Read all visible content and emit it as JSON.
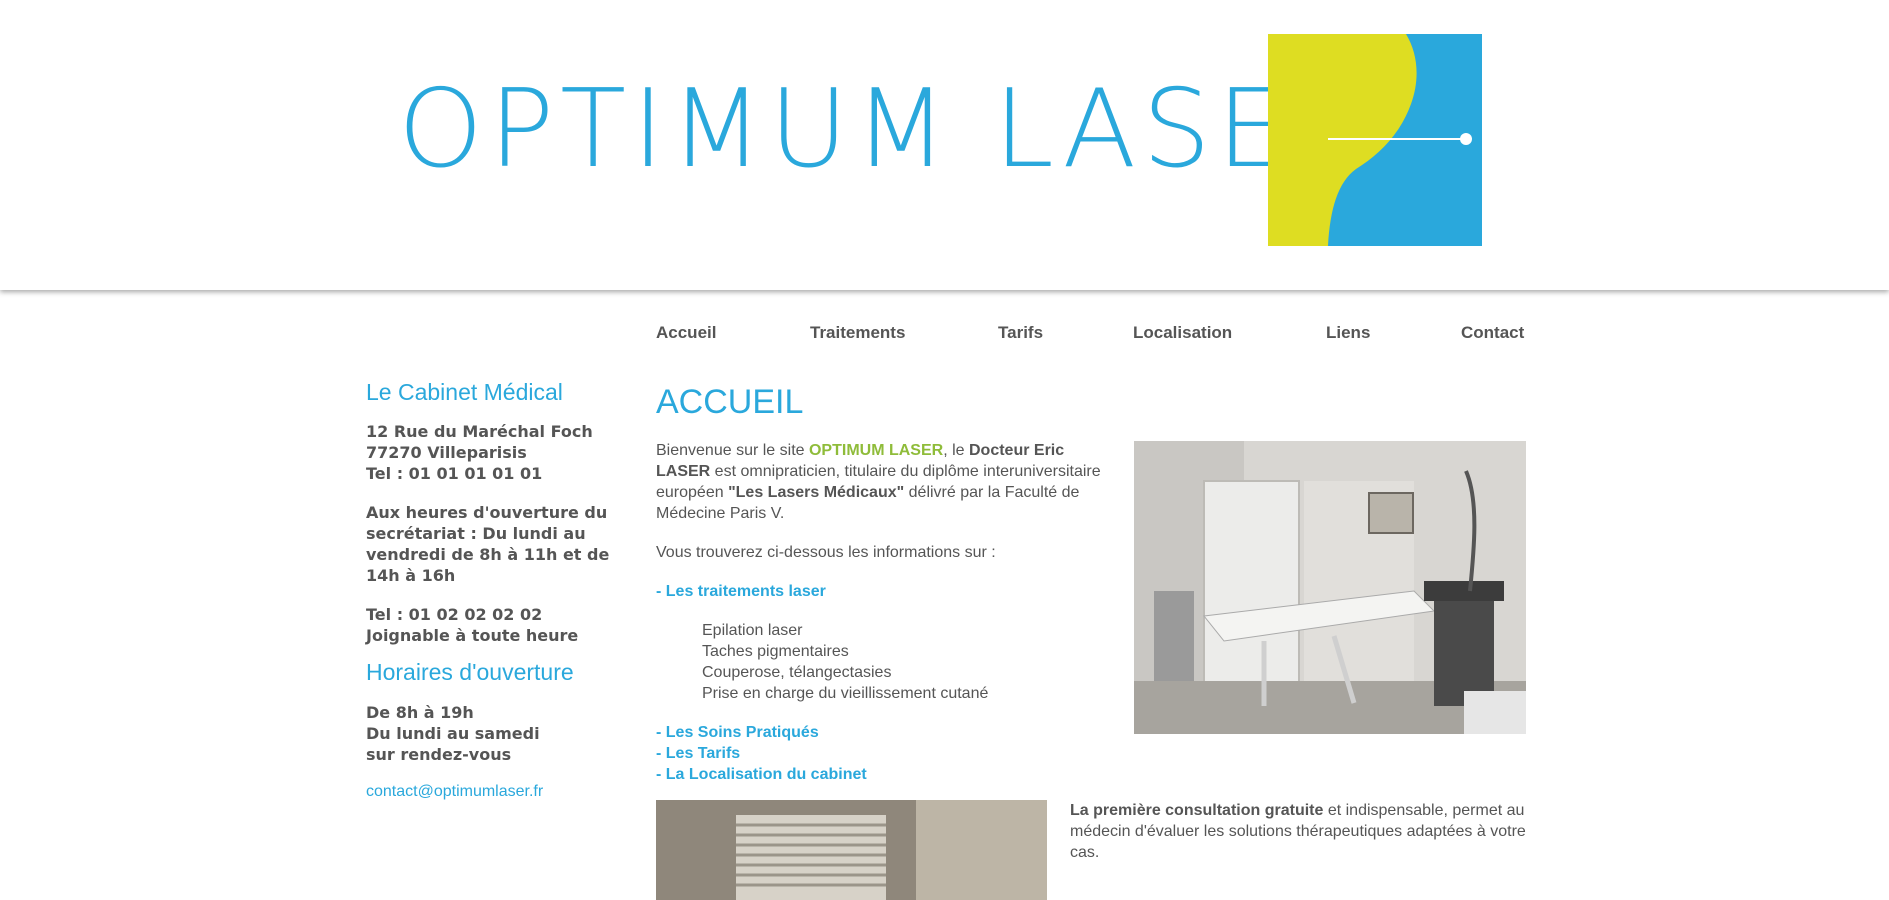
{
  "header": {
    "logo_text": "OPTIMUM LASER",
    "colors": {
      "brand_blue": "#2aa8dc",
      "brand_lime": "#dedd22"
    }
  },
  "nav": {
    "items": [
      {
        "label": "Accueil"
      },
      {
        "label": "Traitements"
      },
      {
        "label": "Tarifs"
      },
      {
        "label": "Localisation"
      },
      {
        "label": "Liens"
      },
      {
        "label": "Contact"
      }
    ]
  },
  "sidebar": {
    "cabinet_title": "Le Cabinet Médical",
    "address_line1": "12 Rue du Maréchal Foch",
    "address_line2": "77270 Villeparisis",
    "tel1": "Tel : 01 01 01 01 01",
    "secretariat": "Aux heures d'ouverture du secrétariat : Du lundi au vendredi de 8h à 11h et de 14h à 16h",
    "tel2": "Tel : 01 02 02 02 02",
    "tel2_note": "Joignable à toute heure",
    "hours_title": "Horaires d'ouverture",
    "hours_line1": "De 8h à 19h",
    "hours_line2": "Du lundi au samedi",
    "hours_line3": "sur rendez-vous",
    "email": "contact@optimumlaser.fr"
  },
  "main": {
    "title": "ACCUEIL",
    "intro_a": "Bienvenue sur le site ",
    "intro_brand": "OPTIMUM LASER",
    "intro_b": ", le ",
    "intro_doctor": "Docteur Eric LASER",
    "intro_c": " est omnipraticien, titulaire du diplôme interuniversitaire européen ",
    "intro_diploma": "\"Les Lasers Médicaux\"",
    "intro_d": " délivré par la Faculté de Médecine Paris V.",
    "info_line": "Vous trouverez ci-dessous les informations sur :",
    "link_treatments": "- Les traitements laser",
    "treatments": [
      "Epilation laser",
      "Taches pigmentaires",
      "Couperose, télangectasies",
      "Prise en charge du vieillissement cutané"
    ],
    "link_soins": "- Les Soins Pratiqués",
    "link_tarifs": "- Les Tarifs",
    "link_localisation": "- La Localisation du cabinet",
    "consult_bold": "La première consultation gratuite",
    "consult_rest": " et indispensable, permet au médecin d'évaluer les solutions thérapeutiques adaptées à votre cas."
  }
}
